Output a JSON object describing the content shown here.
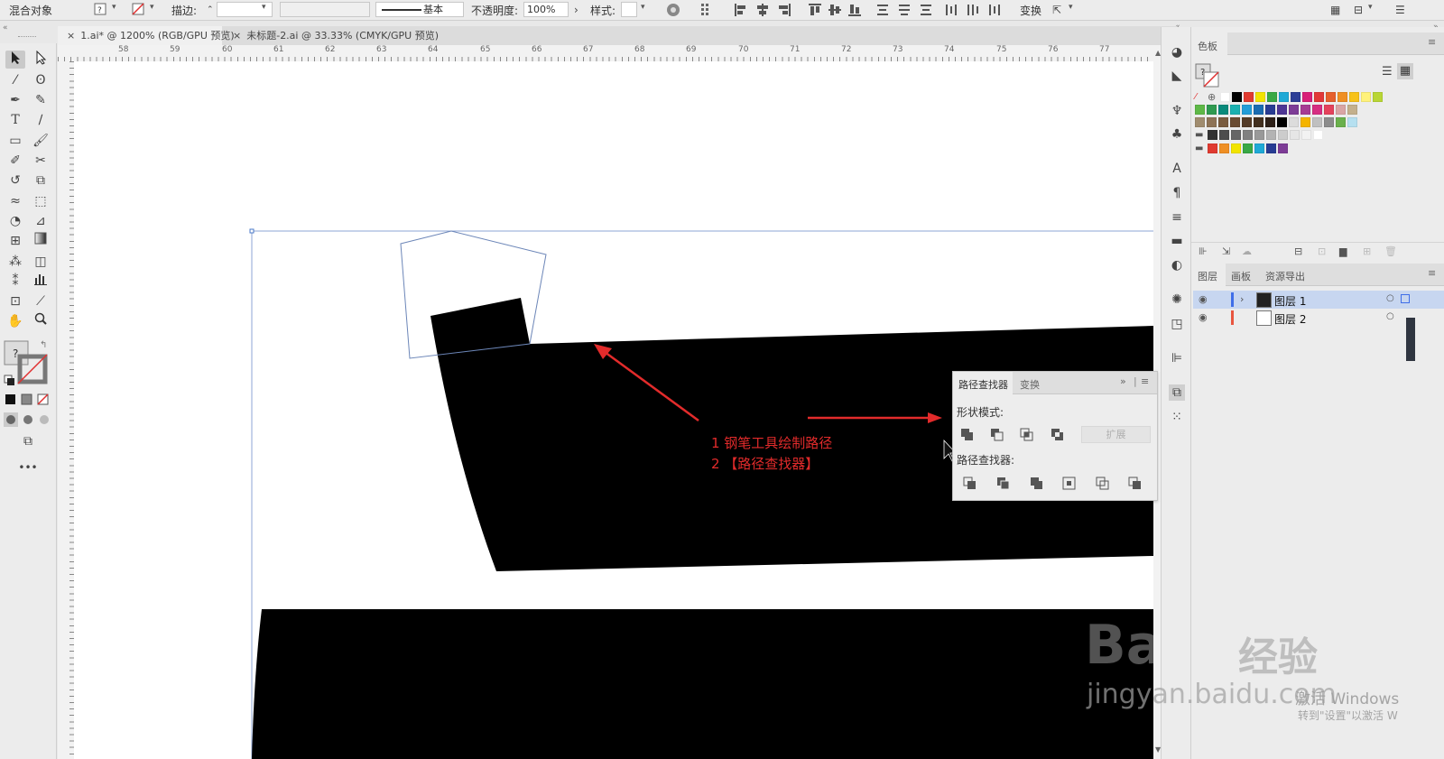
{
  "control_bar": {
    "object_label": "混合对象",
    "stroke_label": "描边:",
    "stroke_profile": "基本",
    "opacity_label": "不透明度:",
    "opacity_value": "100%",
    "style_label": "样式:",
    "transform_label": "变换"
  },
  "tabs": [
    {
      "label": "1.ai* @ 1200% (RGB/GPU 预览)",
      "active": true
    },
    {
      "label": "未标题-2.ai @ 33.33% (CMYK/GPU 预览)",
      "active": false
    }
  ],
  "ruler": {
    "h_labels": [
      "58",
      "59",
      "60",
      "61",
      "62",
      "63",
      "64",
      "65",
      "66",
      "67",
      "68",
      "69",
      "70",
      "71",
      "72",
      "73",
      "74",
      "75",
      "76",
      "77"
    ]
  },
  "swatches_panel": {
    "title": "色板",
    "colors": {
      "row1": [
        "#ffffff",
        "#000000",
        "#e03a30",
        "#f2e400",
        "#39a845",
        "#1fa9d6",
        "#2c3e96",
        "#d81f78",
        "#e23838",
        "#e6602c",
        "#ef8f24",
        "#f7c21a",
        "#fff27b",
        "#b9d635"
      ],
      "row2": [
        "#5eb847",
        "#2f9a50",
        "#0a8a7b",
        "#1ab0b0",
        "#239dd8",
        "#1a6cb1",
        "#283c93",
        "#4d3694",
        "#7d3c96",
        "#a63b93",
        "#d62e82",
        "#e4425c",
        "#d9a5a5",
        "#c4b08c"
      ],
      "row3": [
        "#a08c6f",
        "#8e7356",
        "#7a5c3f",
        "#6a4c32",
        "#553c28",
        "#43301f",
        "#2d2018",
        "#000000",
        "#dcdcdc",
        "#f4b400",
        "#c0c0c0",
        "#8c8c8c",
        "#6ab04c",
        "#b6e0f0"
      ],
      "row4": [
        "#333333",
        "#4d4d4d",
        "#666666",
        "#808080",
        "#999999",
        "#b3b3b3",
        "#cccccc",
        "#e6e6e6",
        "#f2f2f2",
        "#ffffff"
      ],
      "row5": [
        "#e03a30",
        "#ef8f24",
        "#f2e400",
        "#39a845",
        "#1fa9d6",
        "#283c93",
        "#7d3c96"
      ]
    }
  },
  "layers_panel": {
    "tabs": [
      "图层",
      "画板",
      "资源导出"
    ],
    "layers": [
      {
        "name": "图层 1",
        "color": "#3f6ee8",
        "selected": true
      },
      {
        "name": "图层 2",
        "color": "#e8553f",
        "selected": false
      }
    ]
  },
  "pathfinder_panel": {
    "tabs": [
      "路径查找器",
      "变换"
    ],
    "shape_modes_label": "形状模式:",
    "expand_label": "扩展",
    "pathfinders_label": "路径查找器:"
  },
  "annotation": {
    "line1": "1 钢笔工具绘制路径",
    "line2": "2 【路径查找器】",
    "color": "#e22b2b"
  },
  "watermark": {
    "brand": "Bai",
    "brand2": "经验",
    "url": "jingyan.baidu.com",
    "win1": "激活 Windows",
    "win2": "转到\"设置\"以激活 W"
  }
}
